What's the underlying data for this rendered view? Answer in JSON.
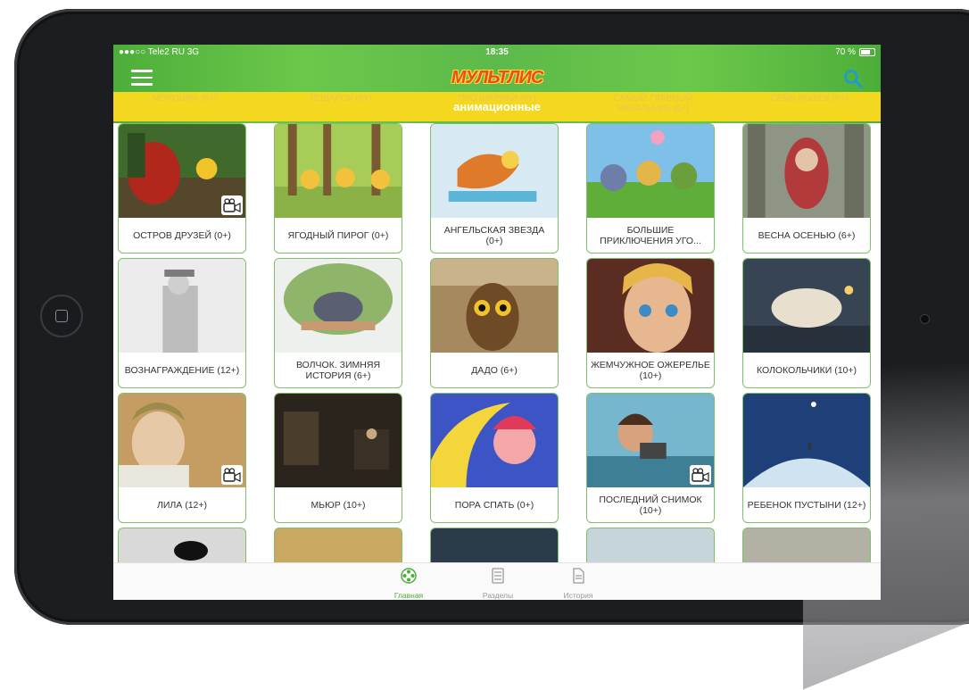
{
  "status_bar": {
    "carrier": "●●●○○ Tele2 RU  3G",
    "time": "18:35",
    "battery": "70 %"
  },
  "header": {
    "logo": "МУЛЬТЛИС",
    "prev_row": [
      "МОРОШКА (6+)",
      "ПОДАРОК (6+)",
      "ПРО ШАРИКИ (6+)",
      "САМЫЙ ГЛАВНЫЙ НАЧАЛЬНИК (6+)",
      "СЕМЬ КОШЕК (0+)"
    ],
    "section_title": "анимационные"
  },
  "cards": [
    {
      "title": "ОСТРОВ ДРУЗЕЙ (0+)",
      "video": true
    },
    {
      "title": "ЯГОДНЫЙ ПИРОГ (0+)",
      "video": false
    },
    {
      "title": "АНГЕЛЬСКАЯ ЗВЕЗДА (0+)",
      "video": false
    },
    {
      "title": "БОЛЬШИЕ ПРИКЛЮЧЕНИЯ УГО...",
      "video": false
    },
    {
      "title": "ВЕСНА ОСЕНЬЮ (6+)",
      "video": false
    },
    {
      "title": "ВОЗНАГРАЖДЕНИЕ (12+)",
      "video": false
    },
    {
      "title": "ВОЛЧОК. ЗИМНЯЯ ИСТОРИЯ (6+)",
      "video": false
    },
    {
      "title": "ДАДО (6+)",
      "video": false
    },
    {
      "title": "ЖЕМЧУЖНОЕ ОЖЕРЕЛЬЕ (10+)",
      "video": false
    },
    {
      "title": "КОЛОКОЛЬЧИКИ (10+)",
      "video": false
    },
    {
      "title": "ЛИЛА (12+)",
      "video": true
    },
    {
      "title": "МЬЮР (10+)",
      "video": false
    },
    {
      "title": "ПОРА СПАТЬ (0+)",
      "video": false
    },
    {
      "title": "ПОСЛЕДНИЙ СНИМОК (10+)",
      "video": true
    },
    {
      "title": "РЕБЕНОК ПУСТЫНИ (12+)",
      "video": false
    }
  ],
  "tabs": [
    {
      "label": "Главная",
      "icon": "film-reel-icon",
      "active": true
    },
    {
      "label": "Разделы",
      "icon": "sections-list-icon",
      "active": false
    },
    {
      "label": "История",
      "icon": "history-document-icon",
      "active": false
    }
  ],
  "colors": {
    "accent_green": "#4cae3a",
    "yellow": "#f3d81f",
    "card_border": "#7fc06b"
  }
}
